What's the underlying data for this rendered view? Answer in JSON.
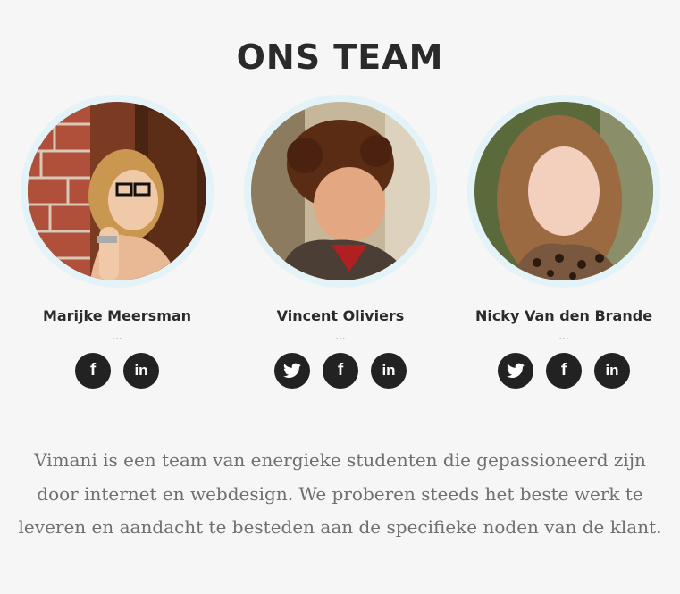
{
  "section": {
    "title": "ONS TEAM"
  },
  "team": [
    {
      "name": "Marijke Meersman",
      "role": "...",
      "socials": [
        "facebook-icon",
        "linkedin-icon"
      ]
    },
    {
      "name": "Vincent Oliviers",
      "role": "...",
      "socials": [
        "twitter-icon",
        "facebook-icon",
        "linkedin-icon"
      ]
    },
    {
      "name": "Nicky Van den Brande",
      "role": "...",
      "socials": [
        "twitter-icon",
        "facebook-icon",
        "linkedin-icon"
      ]
    }
  ],
  "description": "Vimani is een team van energieke studenten die gepassioneerd zijn door internet en webdesign. We proberen steeds het beste werk te leveren en aandacht te besteden aan de specifieke noden van de klant.",
  "colors": {
    "background": "#f6f6f6",
    "ring": "#e3f3f7",
    "icon_bg": "#222222",
    "text": "#2b2b2b",
    "muted": "#6f6f6f"
  }
}
